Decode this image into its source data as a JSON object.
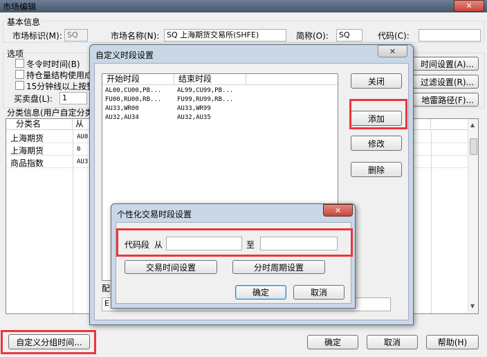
{
  "main": {
    "title": "市场编辑",
    "basic_group": "基本信息",
    "market_id_label": "市场标识(M):",
    "market_id_value": "SQ",
    "market_name_label": "市场名称(N):",
    "market_name_value": "SQ 上海期货交易所(SHFE)",
    "short_label": "简称(O):",
    "short_value": "SQ",
    "code_label": "代码(C):",
    "code_value": "",
    "options_group": "选项",
    "opt_winter": "冬令时时间(B)",
    "opt_position": "持仓量结构使用成",
    "opt_15min": "15分钟线以上按整",
    "buysell_label": "买卖盘(L):",
    "buysell_value": "1",
    "btn_time_settings": "时间设置(A)...",
    "btn_filter_settings": "过滤设置(R)...",
    "btn_mine_path": "地雷路径(F)...",
    "category_label": "分类信息(用户自定分类",
    "columns": [
      "分类名",
      "从"
    ],
    "categories": [
      {
        "name": "上海期货",
        "from": "AU0"
      },
      {
        "name": "上海期货",
        "from": "0"
      },
      {
        "name": "商品指数",
        "from": "AU3"
      }
    ],
    "btn_custom_group": "自定义分组时间...",
    "btn_ok": "确定",
    "btn_cancel": "取消",
    "btn_help": "帮助(H)"
  },
  "custom_period": {
    "title": "自定义时段设置",
    "col_start": "开始时段",
    "col_end": "结束时段",
    "rows": [
      {
        "start": "AL00,CU00,PB...",
        "end": "AL99,CU99,PB..."
      },
      {
        "start": "FU00,RU00,RB...",
        "end": "FU99,RU99,RB..."
      },
      {
        "start": "AU33,WR00",
        "end": "AU33,WR99"
      },
      {
        "start": "AU32,AU34",
        "end": "AU32,AU35"
      }
    ],
    "btn_close": "关闭",
    "btn_add": "添加",
    "btn_modify": "修改",
    "btn_delete": "删除",
    "config_label": "配",
    "bottom_text": "E"
  },
  "personal_time": {
    "title": "个性化交易时段设置",
    "code_range_label": "代码段",
    "from_label": "从",
    "to_label": "至",
    "from_value": "",
    "to_value": "",
    "btn_trade_time": "交易时间设置",
    "btn_period_cycle": "分时周期设置",
    "btn_ok": "确定",
    "btn_cancel": "取消"
  },
  "colors": {
    "highlight": "#e8373c",
    "close_button": "#c9463d"
  }
}
